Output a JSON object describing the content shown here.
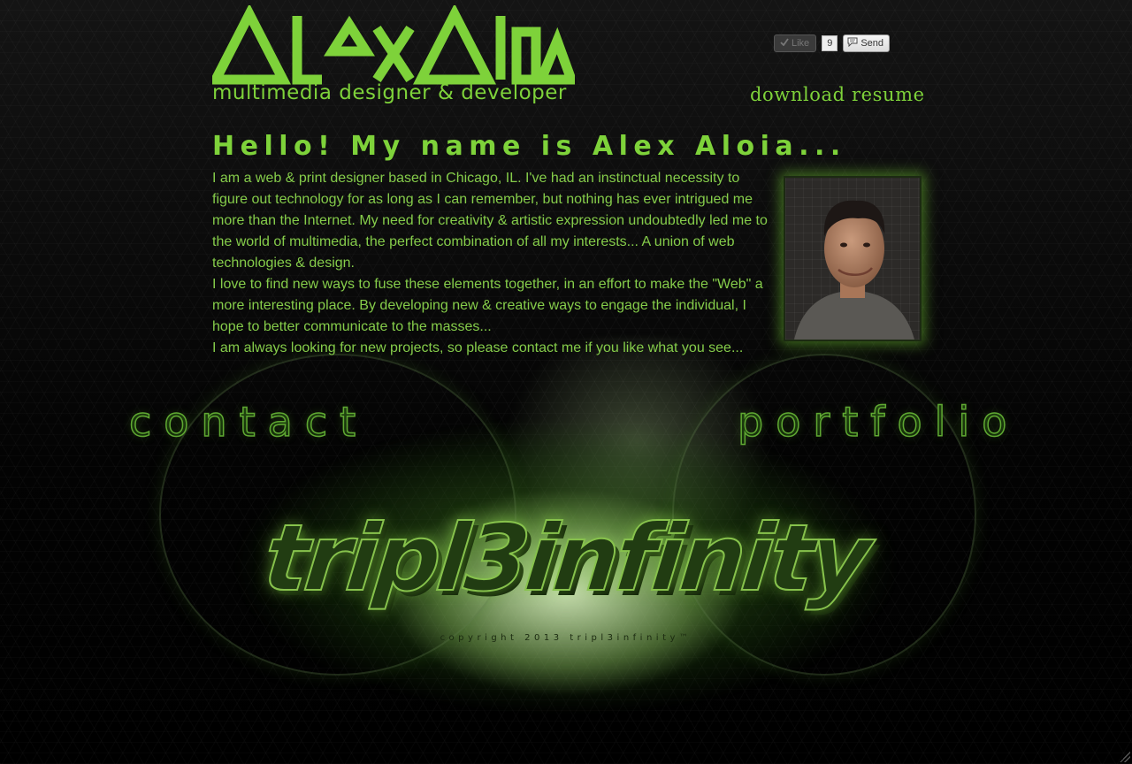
{
  "header": {
    "logo_text": "AlexAloia",
    "tagline": "multimedia designer & developer",
    "download_resume": "download resume"
  },
  "facebook": {
    "like_label": "Like",
    "like_count": "9",
    "send_label": "Send"
  },
  "intro": {
    "heading": "Hello! My name is Alex Aloia...",
    "paragraphs": [
      "I am a web & print designer based in Chicago, IL. I've had an instinctual necessity to figure out technology for as long as I can remember, but nothing has ever intrigued me more than the Internet. My need for creativity & artistic expression undoubtedly led me to the world of multimedia, the perfect combination of all my interests... A union of web technologies & design.",
      "I love to find new ways to fuse these elements together, in an effort to make the \"Web\" a more interesting place. By developing new & creative ways to engage the individual, I hope to better communicate to the masses...",
      "I am always looking for new projects, so please contact me if you like what you see..."
    ]
  },
  "nav": {
    "contact": "contact",
    "portfolio": "portfolio"
  },
  "footer": {
    "brand": "tripl3infinity",
    "copyright": "copyright 2013 tripl3infinity™"
  },
  "colors": {
    "accent": "#7ed23a",
    "background": "#050505"
  },
  "icons": [
    "checkmark-icon",
    "send-message-icon",
    "resize-grip-icon"
  ]
}
